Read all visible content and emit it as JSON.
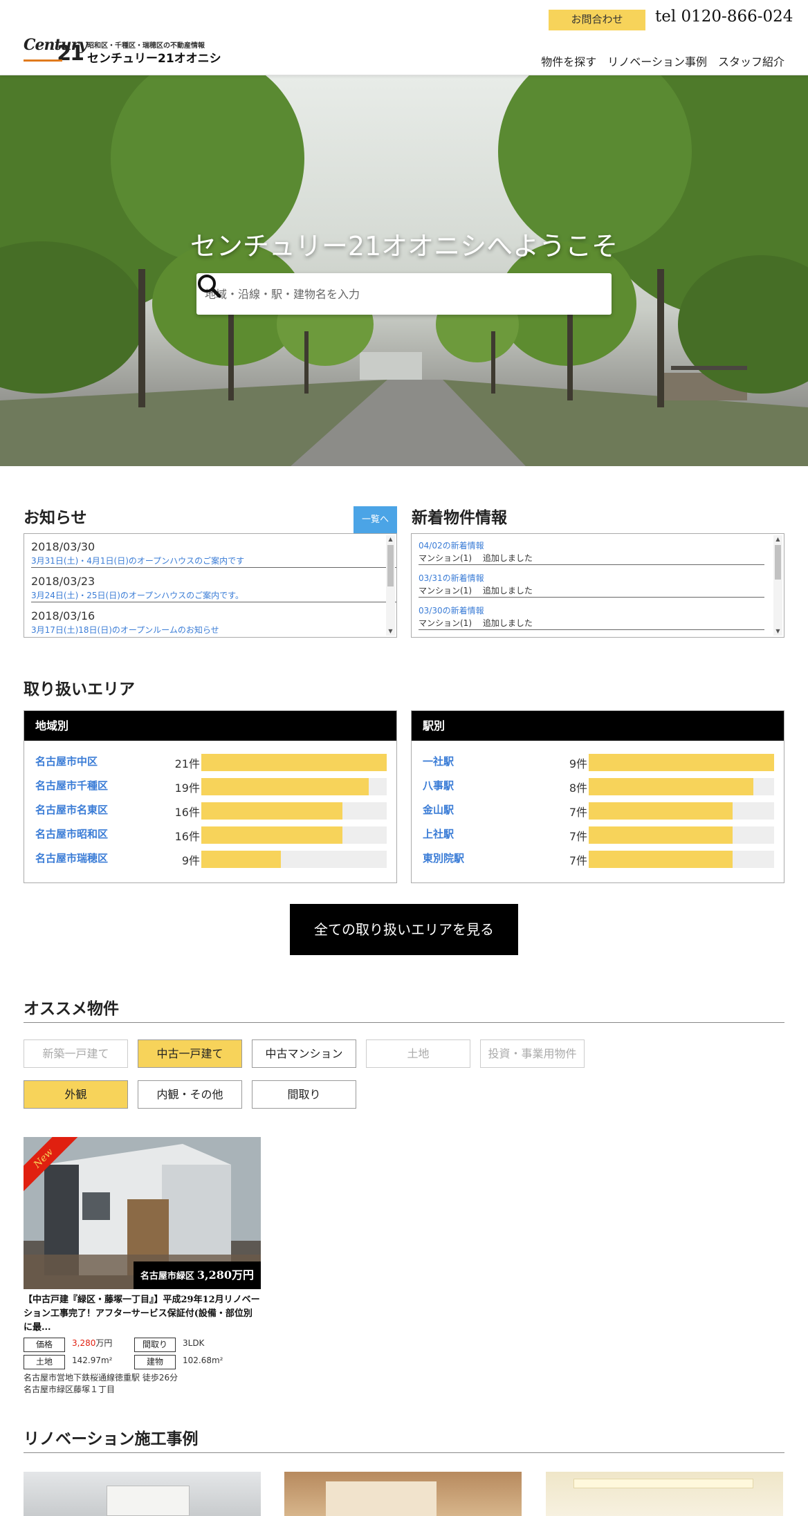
{
  "header": {
    "logo_century": "Century",
    "logo_21": "21",
    "logo_sub": "昭和区・千種区・瑞穂区の不動産情報",
    "logo_name": "センチュリー21オオニシ",
    "contact_label": "お問合わせ",
    "tel": "tel 0120-866-024",
    "nav": [
      "物件を探す",
      "リノベーション事例",
      "スタッフ紹介"
    ]
  },
  "hero": {
    "title": "センチュリー21オオニシへようこそ",
    "search_placeholder": "地域・沿線・駅・建物名を入力"
  },
  "news": {
    "title": "お知らせ",
    "list_button": "一覧へ",
    "items": [
      {
        "date": "2018/03/30",
        "text": "3月31日(土)・4月1日(日)のオープンハウスのご案内です"
      },
      {
        "date": "2018/03/23",
        "text": "3月24日(土)・25日(日)のオープンハウスのご案内です。"
      },
      {
        "date": "2018/03/16",
        "text": "3月17日(土)18日(日)のオープンルームのお知らせ"
      }
    ]
  },
  "new_properties": {
    "title": "新着物件情報",
    "items": [
      {
        "date": "04/02の新着情報",
        "text": "マンション(1)　 追加しました"
      },
      {
        "date": "03/31の新着情報",
        "text": "マンション(1)　 追加しました"
      },
      {
        "date": "03/30の新着情報",
        "text": "マンション(1)　 追加しました"
      }
    ]
  },
  "areas": {
    "title": "取り扱いエリア",
    "by_region": {
      "header": "地域別",
      "rows": [
        {
          "name": "名古屋市中区",
          "count": "21件",
          "value": 21
        },
        {
          "name": "名古屋市千種区",
          "count": "19件",
          "value": 19
        },
        {
          "name": "名古屋市名東区",
          "count": "16件",
          "value": 16
        },
        {
          "name": "名古屋市昭和区",
          "count": "16件",
          "value": 16
        },
        {
          "name": "名古屋市瑞穂区",
          "count": "9件",
          "value": 9
        }
      ],
      "max": 21
    },
    "by_station": {
      "header": "駅別",
      "rows": [
        {
          "name": "一社駅",
          "count": "9件",
          "value": 9
        },
        {
          "name": "八事駅",
          "count": "8件",
          "value": 8
        },
        {
          "name": "金山駅",
          "count": "7件",
          "value": 7
        },
        {
          "name": "上社駅",
          "count": "7件",
          "value": 7
        },
        {
          "name": "東別院駅",
          "count": "7件",
          "value": 7
        }
      ],
      "max": 9
    },
    "all_button": "全ての取り扱いエリアを見る"
  },
  "recommended": {
    "title": "オススメ物件",
    "categories": [
      {
        "label": "新築一戸建て",
        "state": "disabled"
      },
      {
        "label": "中古一戸建て",
        "state": "active"
      },
      {
        "label": "中古マンション",
        "state": "normal"
      },
      {
        "label": "土地",
        "state": "disabled"
      },
      {
        "label": "投資・事業用物件",
        "state": "disabled"
      }
    ],
    "views": [
      {
        "label": "外観",
        "state": "active"
      },
      {
        "label": "内観・その他",
        "state": "normal"
      },
      {
        "label": "間取り",
        "state": "normal"
      }
    ],
    "card": {
      "ribbon": "New",
      "area": "名古屋市緑区",
      "price_tag": "3,280万円",
      "title": "【中古戸建『緑区・藤塚一丁目』】平成29年12月リノベーション工事完了！アフターサービス保証付(設備・部位別に最...",
      "price_label": "価格",
      "price_value": "3,280",
      "price_unit": "万円",
      "layout_label": "間取り",
      "layout_value": "3LDK",
      "land_label": "土地",
      "land_value": "142.97m²",
      "building_label": "建物",
      "building_value": "102.68m²",
      "access": "名古屋市営地下鉄桜通線徳重駅 徒歩26分",
      "address": "名古屋市緑区藤塚１丁目"
    }
  },
  "renovation": {
    "title": "リノベーション施工事例"
  },
  "colors": {
    "accent_yellow": "#f7d35a",
    "link_blue": "#3a7cd6",
    "button_blue": "#4ba4e6",
    "ribbon_red": "#e02010"
  }
}
